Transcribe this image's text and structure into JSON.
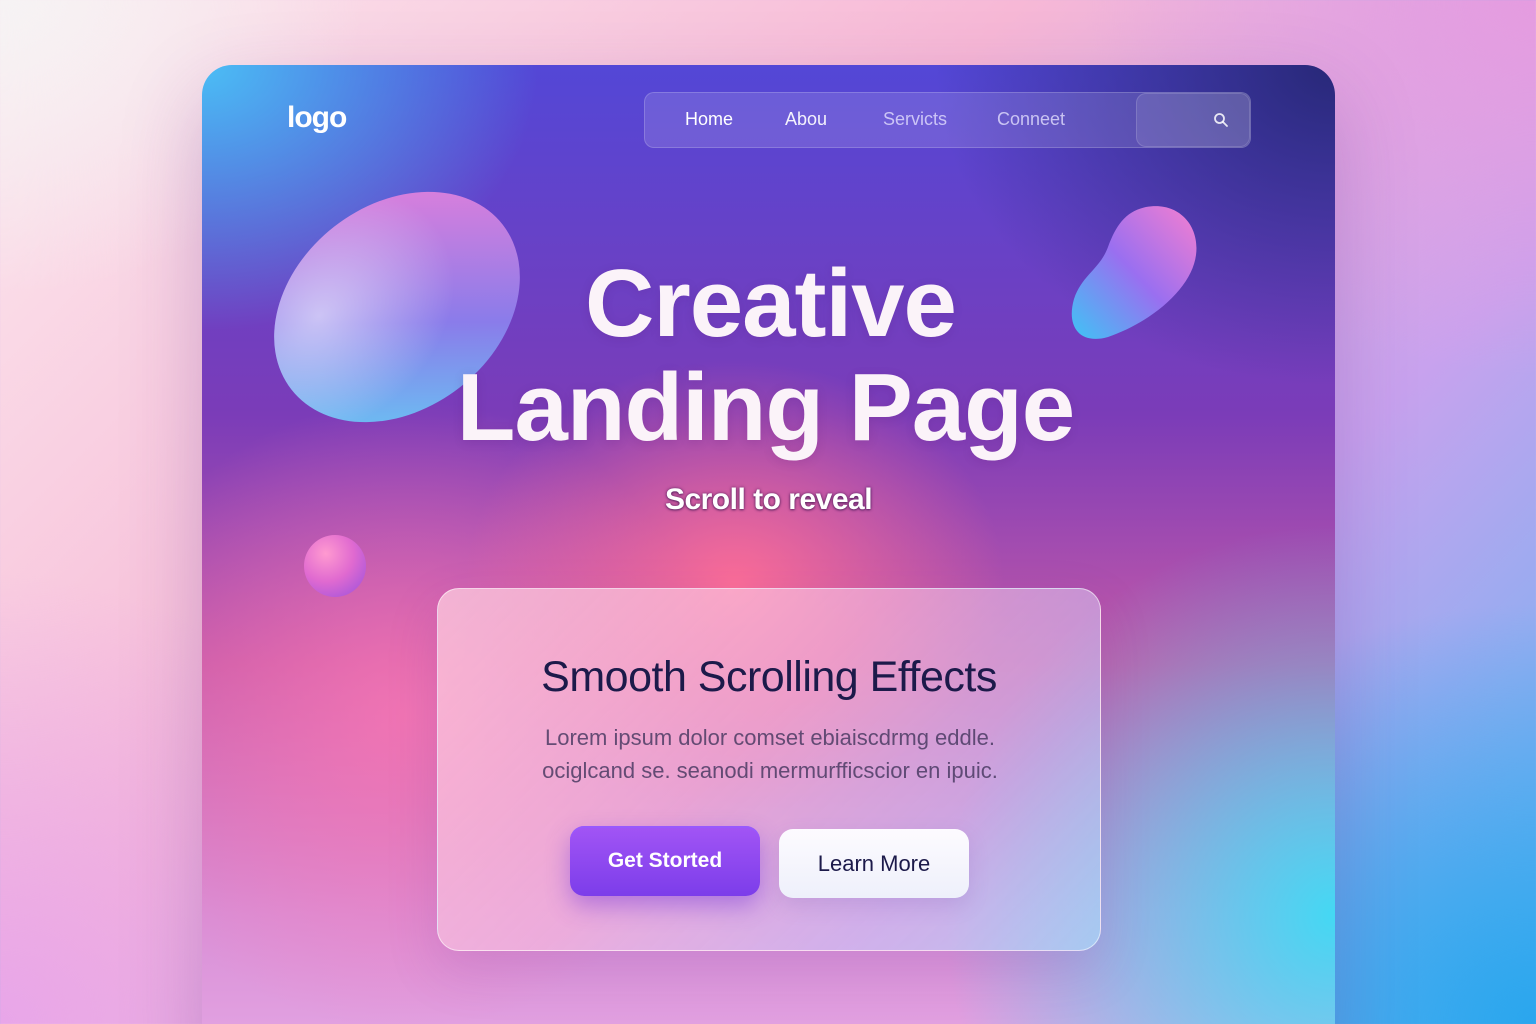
{
  "header": {
    "logo": "logo",
    "nav": [
      {
        "label": "Home"
      },
      {
        "label": "Abou"
      },
      {
        "label": "Servicts"
      },
      {
        "label": "Conneet"
      }
    ],
    "search": {
      "placeholder": ""
    }
  },
  "hero": {
    "title_line1": "Creative",
    "title_line2": "Landing Page",
    "subtitle": "Scroll to reveal"
  },
  "card": {
    "title": "Smooth Scrolling Effects",
    "body_line1": "Lorem ipsum dolor comset ebiaiscdrmg eddle.",
    "body_line2": "ociglcand se. seanodi mermurfficscior en ipuic.",
    "primary_button": "Get Storted",
    "secondary_button": "Learn More"
  },
  "colors": {
    "accent": "#8a46ef",
    "text_dark": "#1c1a4a",
    "hero_text": "#fbf3f9"
  }
}
